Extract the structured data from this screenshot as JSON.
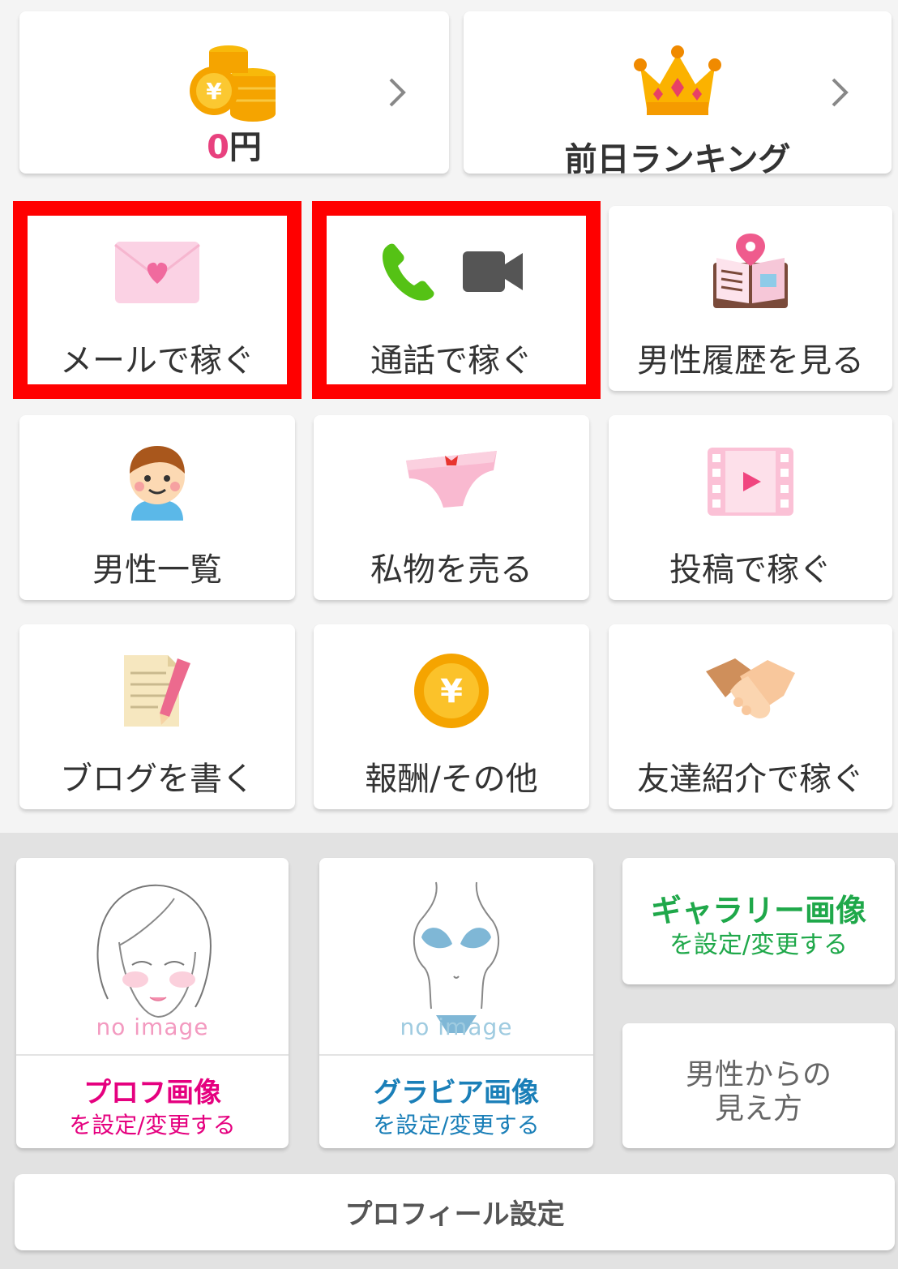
{
  "top_cards": {
    "money": {
      "amount": "0",
      "unit": "円"
    },
    "ranking": {
      "label": "前日ランキング"
    }
  },
  "menu": {
    "mail": "メールで稼ぐ",
    "call": "通話で稼ぐ",
    "history": "男性履歴を見る",
    "men_list": "男性一覧",
    "sell": "私物を売る",
    "post": "投稿で稼ぐ",
    "blog": "ブログを書く",
    "reward": "報酬/その他",
    "friend": "友達紹介で稼ぐ"
  },
  "profile": {
    "no_image": "no image",
    "prof_title": "プロフ画像",
    "prof_sub": "を設定/変更する",
    "gravure_title": "グラビア画像",
    "gravure_sub": "を設定/変更する",
    "gallery_title": "ギャラリー画像",
    "gallery_sub": "を設定/変更する",
    "view_line1": "男性からの",
    "view_line2": "見え方",
    "settings": "プロフィール設定"
  },
  "colors": {
    "highlight": "#ff0000",
    "pink": "#e8417e",
    "prof_title": "#e5007f",
    "gravure_title": "#1a7fb8",
    "gallery_title": "#1fa84a"
  }
}
